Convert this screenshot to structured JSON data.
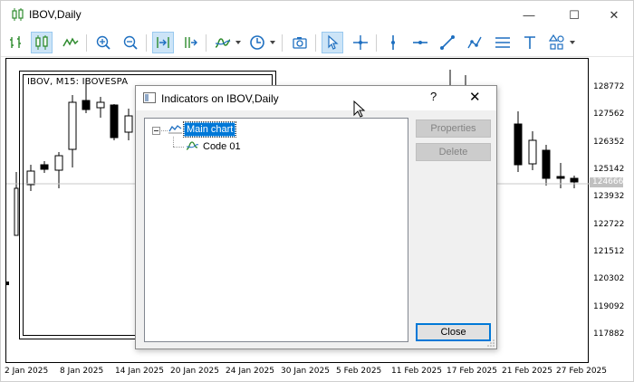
{
  "window": {
    "title": "IBOV,Daily",
    "minimize_glyph": "—",
    "maximize_glyph": "☐",
    "close_glyph": "✕"
  },
  "toolbar": {
    "buttons": [
      {
        "name": "bar-chart-icon",
        "active": false
      },
      {
        "name": "candlestick-chart-icon",
        "active": true
      },
      {
        "name": "line-chart-icon",
        "active": false
      },
      {
        "name": "zoom-in-icon",
        "active": false
      },
      {
        "name": "zoom-out-icon",
        "active": false
      },
      {
        "name": "auto-scroll-icon",
        "active": true
      },
      {
        "name": "chart-shift-icon",
        "active": false
      },
      {
        "name": "indicators-icon",
        "active": false
      },
      {
        "name": "periods-clock-icon",
        "active": false
      },
      {
        "name": "screenshot-camera-icon",
        "active": false
      },
      {
        "name": "cursor-arrow-icon",
        "active": true
      },
      {
        "name": "crosshair-icon",
        "active": false
      },
      {
        "name": "vertical-line-icon",
        "active": false
      },
      {
        "name": "horizontal-line-icon",
        "active": false
      },
      {
        "name": "trendline-icon",
        "active": false
      },
      {
        "name": "polyline-icon",
        "active": false
      },
      {
        "name": "channel-icon",
        "active": false
      },
      {
        "name": "text-icon",
        "active": false
      },
      {
        "name": "shapes-icon",
        "active": false
      }
    ]
  },
  "chart": {
    "subwindow_label": "IBOV, M15:  IBOVESPA",
    "price_labels": [
      "128772",
      "127562",
      "126352",
      "125142",
      "123932",
      "122722",
      "121512",
      "120302",
      "119092",
      "117882"
    ],
    "current_price": "124666",
    "time_labels": [
      "2 Jan 2025",
      "8 Jan 2025",
      "14 Jan 2025",
      "20 Jan 2025",
      "24 Jan 2025",
      "30 Jan 2025",
      "5 Feb 2025",
      "11 Feb 2025",
      "17 Feb 2025",
      "21 Feb 2025",
      "27 Feb 2025"
    ]
  },
  "dialog": {
    "title": "Indicators on IBOV,Daily",
    "help_glyph": "?",
    "close_glyph": "✕",
    "tree": {
      "root_label": "Main chart",
      "child_label": "Code 01"
    },
    "buttons": {
      "properties": "Properties",
      "delete": "Delete",
      "close": "Close"
    }
  }
}
